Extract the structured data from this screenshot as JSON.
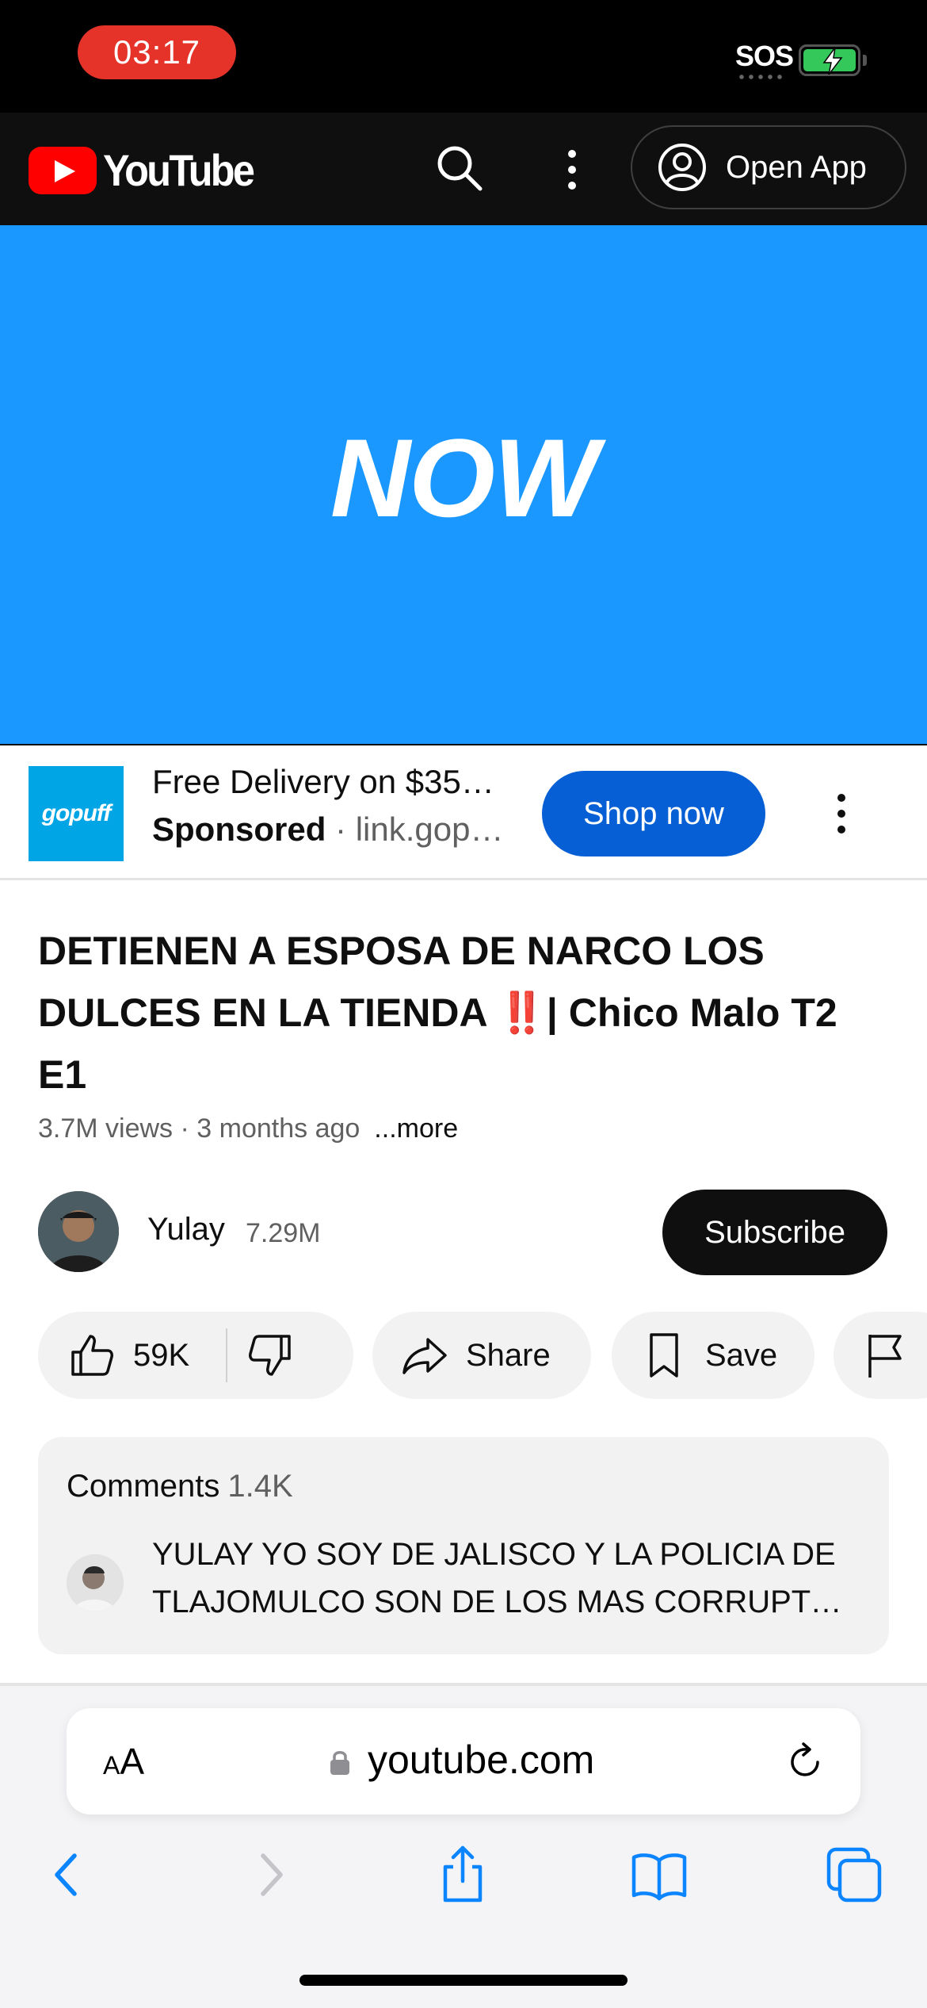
{
  "status_bar": {
    "time": "03:17",
    "sos": "SOS",
    "battery_state": "charging"
  },
  "header": {
    "logo_text": "YouTube",
    "icons": [
      "search-icon",
      "more-vert-icon",
      "account-icon"
    ],
    "open_app_label": "Open App"
  },
  "video": {
    "overlay_text": "NOW",
    "background_color": "#1a98ff"
  },
  "ad": {
    "logo_text": "gopuff",
    "title": "Free Delivery on $35…",
    "sponsored_label": "Sponsored",
    "separator": " · ",
    "domain": "link.gop…",
    "cta_label": "Shop now",
    "cta_color": "#065fd4"
  },
  "video_info": {
    "title_text": "DETIENEN A ESPOSA DE NARCO LOS DULCES EN LA TIENDA ",
    "title_emoji": "‼️",
    "title_suffix": "| Chico Malo T2 E1",
    "meta": "3.7M views · 3 months ago",
    "more_label": "...more"
  },
  "channel": {
    "name": "Yulay",
    "subscribers": "7.29M",
    "subscribe_label": "Subscribe"
  },
  "actions": {
    "like_count": "59K",
    "share_label": "Share",
    "save_label": "Save"
  },
  "comments": {
    "label": "Comments",
    "count": "1.4K",
    "top_comment": "YULAY YO SOY DE JALISCO Y LA POLICIA DE TLAJOMULCO SON DE LOS MAS CORRUPTOS QUE HAY"
  },
  "safari": {
    "text_size_label_small": "A",
    "text_size_label_big": "A",
    "url": "youtube.com",
    "accent_color": "#0a84ff"
  }
}
